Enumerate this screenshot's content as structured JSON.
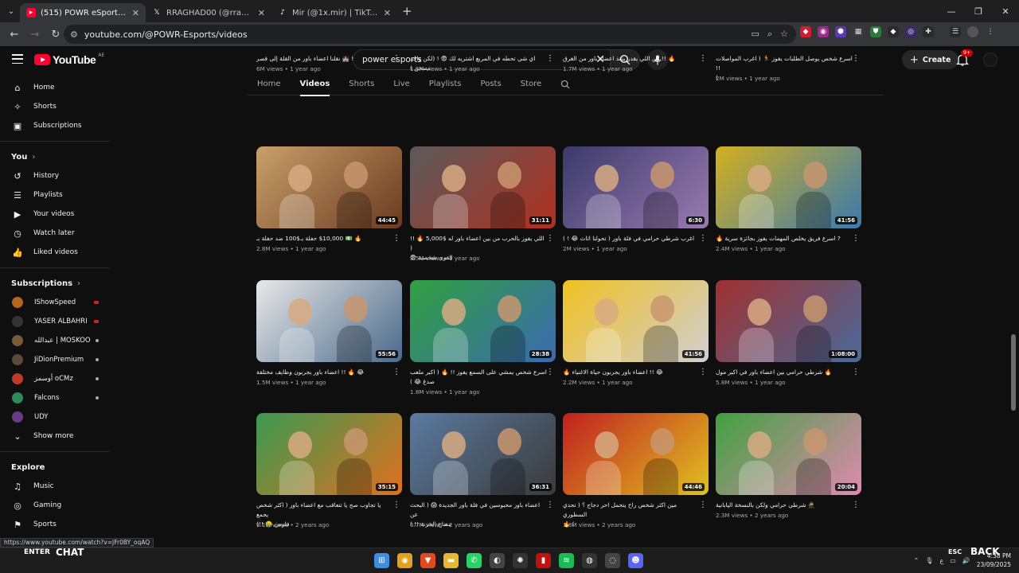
{
  "browser": {
    "tabs": [
      {
        "title": "(515) POWR eSports | باور - You",
        "active": true,
        "favicon": "youtube-icon"
      },
      {
        "title": "RRAGHAD00 (@rraghad006) / X",
        "active": false,
        "favicon": "x-icon"
      },
      {
        "title": "Mir (@1x.mir) | TikTok",
        "active": false,
        "favicon": "tiktok-icon"
      }
    ],
    "url": "youtube.com/@POWR-Esports/videos",
    "status_url": "https://www.youtube.com/watch?v=JFr0BY_oqAQ"
  },
  "header": {
    "logo_text": "YouTube",
    "region": "AE",
    "search_value": "power esports",
    "create_label": "Create",
    "notif_badge": "9+"
  },
  "sidebar": {
    "main": [
      {
        "label": "Home",
        "icon": "home-icon",
        "glyph": "⌂"
      },
      {
        "label": "Shorts",
        "icon": "shorts-icon",
        "glyph": "✧"
      },
      {
        "label": "Subscriptions",
        "icon": "subscriptions-icon",
        "glyph": "▣"
      }
    ],
    "you_title": "You",
    "you": [
      {
        "label": "History",
        "icon": "history-icon",
        "glyph": "↺"
      },
      {
        "label": "Playlists",
        "icon": "playlists-icon",
        "glyph": "☰"
      },
      {
        "label": "Your videos",
        "icon": "your-videos-icon",
        "glyph": "▶"
      },
      {
        "label": "Watch later",
        "icon": "watch-later-icon",
        "glyph": "◷"
      },
      {
        "label": "Liked videos",
        "icon": "liked-icon",
        "glyph": "👍"
      }
    ],
    "subs_title": "Subscriptions",
    "subs": [
      {
        "label": "IShowSpeed",
        "color": "#b5651d",
        "dot": "red"
      },
      {
        "label": "YASER ALBAHRI",
        "color": "#333333",
        "dot": "red"
      },
      {
        "label": "عبدالله | MOSKOO",
        "color": "#7a5a3a",
        "dot": "grey"
      },
      {
        "label": "JiDionPremium",
        "color": "#5a4a3a",
        "dot": "grey"
      },
      {
        "label": "أوسمز oCMz",
        "color": "#c0392b",
        "dot": "grey"
      },
      {
        "label": "Falcons",
        "color": "#2e8b57",
        "dot": "grey"
      },
      {
        "label": "UDY",
        "color": "#6a3a8a",
        "dot": "none"
      }
    ],
    "show_more": "Show more",
    "explore_title": "Explore",
    "explore": [
      {
        "label": "Music",
        "icon": "music-icon",
        "glyph": "♫"
      },
      {
        "label": "Gaming",
        "icon": "gaming-icon",
        "glyph": "◎"
      },
      {
        "label": "Sports",
        "icon": "sports-icon",
        "glyph": "⚑"
      }
    ]
  },
  "channel_tabs": [
    "Home",
    "Videos",
    "Shorts",
    "Live",
    "Playlists",
    "Posts",
    "Store"
  ],
  "videos": [
    {
      "title": "! 🏰 نقلنا اعضاء باور من القلة إلى قصر",
      "views": "6M views",
      "age": "1 year ago",
      "duration": "",
      "c1": "#3a3a3a",
      "c2": "#555"
    },
    {
      "title": "اي شي تحطه في المربع اشتريه لك 😨 ! (لكن واحد مصخن )",
      "views": "1.6M views",
      "age": "1 year ago",
      "duration": "",
      "c1": "#3a3a3a",
      "c2": "#555"
    },
    {
      "title": "🔥 !! من اللي يقدر ينقذ اعضاء باور من الغرق",
      "views": "1.7M views",
      "age": "1 year ago",
      "duration": "",
      "c1": "#3a3a3a",
      "c2": "#555"
    },
    {
      "title": "اسرع شخص يوصل الطلبات يفوز 🏃 ( اغرب المواصلات !!\n)",
      "views": "2M views",
      "age": "1 year ago",
      "duration": "",
      "c1": "#3a3a3a",
      "c2": "#555"
    },
    {
      "title": "🔥 💵 $10,000 حفلة بـ$100 ضد حفلة بـ",
      "views": "2.8M views",
      "age": "1 year ago",
      "duration": "44:45",
      "c1": "#c9a06a",
      "c2": "#6b3a20"
    },
    {
      "title": "اللي يفوز بالحرب من بين اعضاء باور له $5,000 🔥 !! (\nالقوى شخصية 😨",
      "views": "3.5M views",
      "age": "1 year ago",
      "duration": "31:11",
      "c1": "#5a5a5a",
      "c2": "#b03020"
    },
    {
      "title": "اغرب شرطي حرامي في فلة باور ( تحولنا اثاث 😂 ! )",
      "views": "2M views",
      "age": "1 year ago",
      "duration": "6:30",
      "c1": "#3a3a6a",
      "c2": "#9a7ab0"
    },
    {
      "title": "? اسرع فريق يخلص المهمات يفوز بجائزة سرية 🔥",
      "views": "2.4M views",
      "age": "1 year ago",
      "duration": "41:56",
      "c1": "#d4b020",
      "c2": "#3a7ab0"
    },
    {
      "title": "😂 🔥 !! اعضاء باور يجربون وظايف مختلفة",
      "views": "1.5M views",
      "age": "1 year ago",
      "duration": "55:56",
      "c1": "#e8e8e8",
      "c2": "#4a6a8a"
    },
    {
      "title": "اسرع شخص يمشي على السمع يفوز !! 🔥 ( اكبر ملعب\nصدغ 😂 )",
      "views": "1.8M views",
      "age": "1 year ago",
      "duration": "28:38",
      "c1": "#30a040",
      "c2": "#3a6ab0"
    },
    {
      "title": "😂 !! اعضاء باور يجربون حياة الاغنياء 🔥",
      "views": "2.2M views",
      "age": "1 year ago",
      "duration": "41:56",
      "c1": "#f0c020",
      "c2": "#d0d0d0"
    },
    {
      "title": "🔥 شرطي حرامي بين اعضاء باور في اكبر مول",
      "views": "5.8M views",
      "age": "1 year ago",
      "duration": "1:08:00",
      "c1": "#a03030",
      "c2": "#4a6a9a"
    },
    {
      "title": "يا تجاوب صح يا تتعاقب مع اعضاء باور ( اكثر شخص يجمع\nفلوس 🤑 !!)",
      "views": "1.1M views",
      "age": "2 years ago",
      "duration": "35:15",
      "c1": "#3a9a50",
      "c2": "#e07020"
    },
    {
      "title": "اعضاء باور محبوسين في فلة باور الجديدة 😱 ( البحث عن\nمفتاح الخزنة !! )",
      "views": "6.7M views",
      "age": "2 years ago",
      "duration": "36:31",
      "c1": "#5a7aa0",
      "c2": "#3a3a3a"
    },
    {
      "title": "مين اكثر شخص راح يتحمل احر دجاج ؟ ( تحدي السطوري\n) 🔥",
      "views": "1.8M views",
      "age": "2 years ago",
      "duration": "44:46",
      "c1": "#c02020",
      "c2": "#e0c020"
    },
    {
      "title": "🥷 شرطي حرامي ولكن بالنسخة اليابانية",
      "views": "2.3M views",
      "age": "2 years ago",
      "duration": "20:04",
      "c1": "#40a040",
      "c2": "#e08ab0"
    }
  ],
  "taskbar": {
    "enter": "ENTER",
    "chat": "CHAT",
    "esc": "ESC",
    "back": "BACK",
    "lang": "ع",
    "time": "4:38 PM",
    "date": "23/09/2025",
    "apps": [
      {
        "icon": "windows-start-icon",
        "color": "#3a8ee6",
        "glyph": "⊞"
      },
      {
        "icon": "chrome-icon",
        "color": "#e0a020",
        "glyph": "◉"
      },
      {
        "icon": "brave-icon",
        "color": "#e04a20",
        "glyph": "▼"
      },
      {
        "icon": "file-explorer-icon",
        "color": "#e8b830",
        "glyph": "▬"
      },
      {
        "icon": "whatsapp-icon",
        "color": "#25d366",
        "glyph": "✆"
      },
      {
        "icon": "app-icon",
        "color": "#444",
        "glyph": "◐"
      },
      {
        "icon": "chatgpt-icon",
        "color": "#333",
        "glyph": "✺"
      },
      {
        "icon": "app-red-icon",
        "color": "#c01010",
        "glyph": "▮"
      },
      {
        "icon": "spotify-icon",
        "color": "#1db954",
        "glyph": "≋"
      },
      {
        "icon": "obs-icon",
        "color": "#333",
        "glyph": "◍"
      },
      {
        "icon": "steam-icon",
        "color": "#444",
        "glyph": "◌"
      },
      {
        "icon": "discord-icon",
        "color": "#5865f2",
        "glyph": "☻"
      }
    ]
  }
}
